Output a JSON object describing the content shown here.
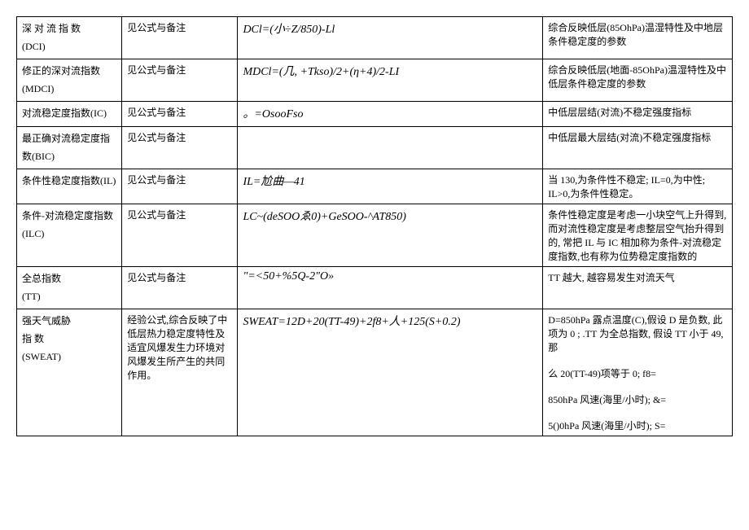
{
  "rows": [
    {
      "name": "深 对 流 指 数\n(DCI)",
      "desc": "见公式与备注",
      "formula": "DCl=(小÷Z/850)-Ll",
      "note": "综合反映低层(85OhPa)温湿特性及中地层条件稳定度的参数"
    },
    {
      "name": "修正的深对流指数\n(MDCI)",
      "desc": "见公式与备注",
      "formula": "MDCl=(几, +Tkso)/2+(η+4)/2-LI",
      "note": "综合反映低层(地面-85OhPa)温湿特性及中低层条件稳定度的参数"
    },
    {
      "name": "对流稳定度指数(IC)",
      "desc": "见公式与备注",
      "formula": "。=OsooFso",
      "note": "中低层层结(对流)不稳定强度指标"
    },
    {
      "name": "最正确对流稳定度指数(BIC)",
      "desc": "见公式与备注",
      "formula": "",
      "note": "中低层最大层结(对流)不稳定强度指标"
    },
    {
      "name": "条件性稳定度指数(IL)",
      "desc": "见公式与备注",
      "formula": "IL=尬曲—41",
      "note": "当 130,为条件性不稳定; IL=0,为中性; IL>0,为条件性稳定。"
    },
    {
      "name": "条件-对流稳定度指数(ILC)",
      "desc": "见公式与备注",
      "formula": "LC~(deSOOゑ0)+GeSOO-^AT850)",
      "note": "条件性稳定度是考虑一小块空气上升得到, 而对流性稳定度是考虑整层空气抬升得到的, 常把 IL 与 IC 相加称为条件-对流稳定度指数,也有称为位势稳定度指数的"
    },
    {
      "name": "全总指数\n(TT)",
      "desc": "见公式与备注",
      "formula": "\"=<50+%5Q-2\"O»",
      "note": "TT 越大, 越容易发生对流天气"
    },
    {
      "name": "强天气威胁\n指 数\n(SWEAT)",
      "desc": "经验公式,综合反映了中低层热力稳定度特性及适宜风爆发生力环境对风爆发生所产生的共同作用。",
      "formula": "SWEAT=12D+20(TT-49)+2f8+人+125(S+0.2)",
      "note": "D=850hPa 露点温度(C),假设 D 是负数, 此项为 0 ; .TT 为全总指数, 假设 TT 小于 49,那\n\n么 20(TT-49)项等于 0; f8=\n\n850hPa 风速(海里/小时); &=\n\n5()0hPa 风速(海里/小时); S="
    }
  ]
}
